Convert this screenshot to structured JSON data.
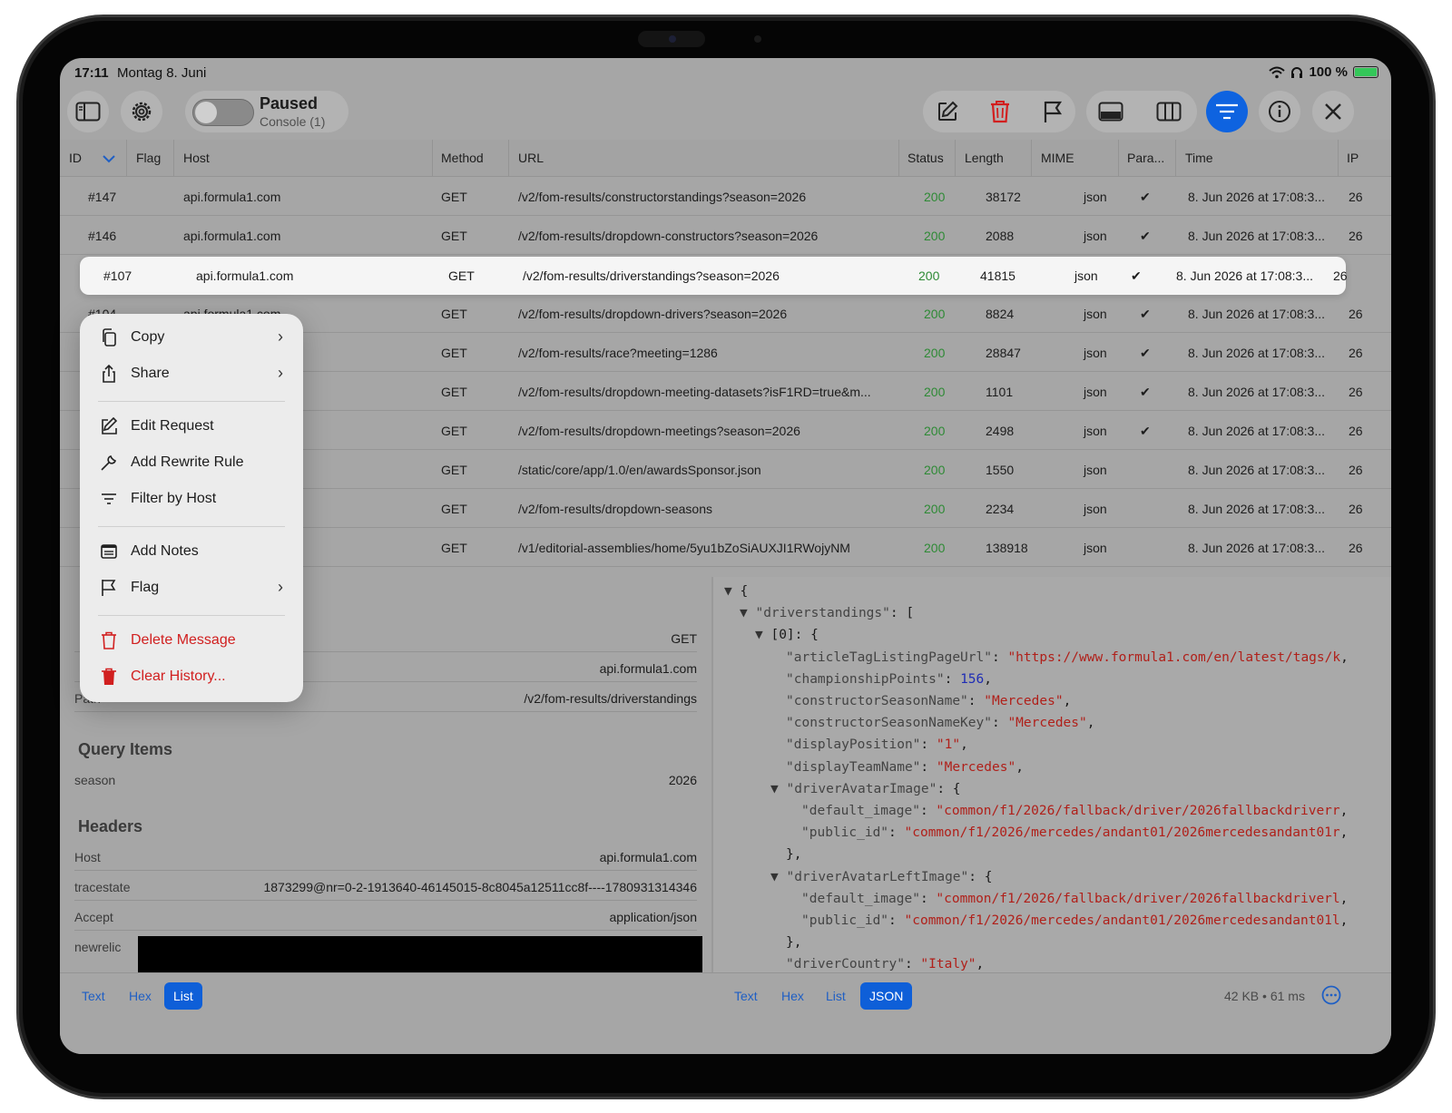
{
  "status_bar": {
    "time": "17:11",
    "date": "Montag 8. Juni",
    "battery": "100 %"
  },
  "toolbar": {
    "toggle_title": "Paused",
    "toggle_subtitle": "Console (1)",
    "accent": "#0e63e0"
  },
  "table": {
    "columns": [
      "ID",
      "Flag",
      "Host",
      "Method",
      "URL",
      "Status",
      "Length",
      "MIME",
      "Para...",
      "Time",
      "IP"
    ],
    "rows": [
      {
        "id": "#147",
        "host": "api.formula1.com",
        "method": "GET",
        "url": "/v2/fom-results/constructorstandings?season=2026",
        "status": "200",
        "length": "38172",
        "mime": "json",
        "params": "✔",
        "time": "8. Jun 2026 at 17:08:3...",
        "ip": "26"
      },
      {
        "id": "#146",
        "host": "api.formula1.com",
        "method": "GET",
        "url": "/v2/fom-results/dropdown-constructors?season=2026",
        "status": "200",
        "length": "2088",
        "mime": "json",
        "params": "✔",
        "time": "8. Jun 2026 at 17:08:3...",
        "ip": "26"
      },
      {
        "id": "#107",
        "host": "api.formula1.com",
        "method": "GET",
        "url": "/v2/fom-results/driverstandings?season=2026",
        "status": "200",
        "length": "41815",
        "mime": "json",
        "params": "✔",
        "time": "8. Jun 2026 at 17:08:3...",
        "ip": "26"
      },
      {
        "id": "#104",
        "host": "api.formula1.com",
        "method": "GET",
        "url": "/v2/fom-results/dropdown-drivers?season=2026",
        "status": "200",
        "length": "8824",
        "mime": "json",
        "params": "✔",
        "time": "8. Jun 2026 at 17:08:3...",
        "ip": "26"
      },
      {
        "id": "",
        "host": "",
        "method": "GET",
        "url": "/v2/fom-results/race?meeting=1286",
        "status": "200",
        "length": "28847",
        "mime": "json",
        "params": "✔",
        "time": "8. Jun 2026 at 17:08:3...",
        "ip": "26"
      },
      {
        "id": "",
        "host": "",
        "method": "GET",
        "url": "/v2/fom-results/dropdown-meeting-datasets?isF1RD=true&m...",
        "status": "200",
        "length": "1101",
        "mime": "json",
        "params": "✔",
        "time": "8. Jun 2026 at 17:08:3...",
        "ip": "26"
      },
      {
        "id": "",
        "host": "",
        "method": "GET",
        "url": "/v2/fom-results/dropdown-meetings?season=2026",
        "status": "200",
        "length": "2498",
        "mime": "json",
        "params": "✔",
        "time": "8. Jun 2026 at 17:08:3...",
        "ip": "26"
      },
      {
        "id": "",
        "host": "",
        "method": "GET",
        "url": "/static/core/app/1.0/en/awardsSponsor.json",
        "status": "200",
        "length": "1550",
        "mime": "json",
        "params": "",
        "time": "8. Jun 2026 at 17:08:3...",
        "ip": "26"
      },
      {
        "id": "",
        "host": "",
        "method": "GET",
        "url": "/v2/fom-results/dropdown-seasons",
        "status": "200",
        "length": "2234",
        "mime": "json",
        "params": "",
        "time": "8. Jun 2026 at 17:08:3...",
        "ip": "26"
      },
      {
        "id": "",
        "host": "",
        "method": "GET",
        "url": "/v1/editorial-assemblies/home/5yu1bZoSiAUXJI1RWojyNM",
        "status": "200",
        "length": "138918",
        "mime": "json",
        "params": "",
        "time": "8. Jun 2026 at 17:08:3...",
        "ip": "26"
      }
    ]
  },
  "context_menu": {
    "items": [
      "Copy",
      "Share",
      "Edit Request",
      "Add Rewrite Rule",
      "Filter by Host",
      "Add Notes",
      "Flag",
      "Delete Message",
      "Clear History..."
    ]
  },
  "request": {
    "method_value": "GET",
    "host_value": "api.formula1.com",
    "path_label": "Path",
    "path_value": "/v2/fom-results/driverstandings",
    "query_title": "Query Items",
    "query_items": [
      {
        "key": "season",
        "value": "2026"
      }
    ],
    "headers_title": "Headers",
    "headers": [
      {
        "key": "Host",
        "value": "api.formula1.com"
      },
      {
        "key": "tracestate",
        "value": "1873299@nr=0-2-1913640-46145015-8c8045a12511cc8f----1780931314346"
      },
      {
        "key": "Accept",
        "value": "application/json"
      },
      {
        "key": "newrelic",
        "value": ""
      }
    ]
  },
  "json_view": {
    "lines": [
      {
        "t": "▼ ",
        "k": "{",
        "v": "",
        "indent": 0,
        "kind": "p"
      },
      {
        "t": "▼ ",
        "k": "\"driverstandings\"",
        "v": ": [",
        "indent": 1,
        "kind": "pk"
      },
      {
        "t": "▼ ",
        "k": "[0]: {",
        "v": "",
        "indent": 2,
        "kind": "p"
      },
      {
        "t": "",
        "k": "\"articleTagListingPageUrl\"",
        "v": "\"https://www.formula1.com/en/latest/tags/k",
        "indent": 4,
        "kind": "s"
      },
      {
        "t": "",
        "k": "\"championshipPoints\"",
        "v": "156",
        "indent": 4,
        "kind": "n"
      },
      {
        "t": "",
        "k": "\"constructorSeasonName\"",
        "v": "\"Mercedes\"",
        "indent": 4,
        "kind": "s"
      },
      {
        "t": "",
        "k": "\"constructorSeasonNameKey\"",
        "v": "\"Mercedes\"",
        "indent": 4,
        "kind": "s"
      },
      {
        "t": "",
        "k": "\"displayPosition\"",
        "v": "\"1\"",
        "indent": 4,
        "kind": "s"
      },
      {
        "t": "",
        "k": "\"displayTeamName\"",
        "v": "\"Mercedes\"",
        "indent": 4,
        "kind": "s"
      },
      {
        "t": "▼ ",
        "k": "\"driverAvatarImage\"",
        "v": ": {",
        "indent": 3,
        "kind": "pk"
      },
      {
        "t": "",
        "k": "\"default_image\"",
        "v": "\"common/f1/2026/fallback/driver/2026fallbackdriverr",
        "indent": 5,
        "kind": "s"
      },
      {
        "t": "",
        "k": "\"public_id\"",
        "v": "\"common/f1/2026/mercedes/andant01/2026mercedesandant01r",
        "indent": 5,
        "kind": "s"
      },
      {
        "t": "",
        "k": "},",
        "v": "",
        "indent": 4,
        "kind": "p"
      },
      {
        "t": "▼ ",
        "k": "\"driverAvatarLeftImage\"",
        "v": ": {",
        "indent": 3,
        "kind": "pk"
      },
      {
        "t": "",
        "k": "\"default_image\"",
        "v": "\"common/f1/2026/fallback/driver/2026fallbackdriverl",
        "indent": 5,
        "kind": "s"
      },
      {
        "t": "",
        "k": "\"public_id\"",
        "v": "\"common/f1/2026/mercedes/andant01/2026mercedesandant01l",
        "indent": 5,
        "kind": "s"
      },
      {
        "t": "",
        "k": "},",
        "v": "",
        "indent": 4,
        "kind": "p"
      },
      {
        "t": "",
        "k": "\"driverCountry\"",
        "v": "\"Italy\"",
        "indent": 4,
        "kind": "s"
      }
    ]
  },
  "bottom_left_tabs": [
    "Text",
    "Hex",
    "List"
  ],
  "bottom_right_tabs": [
    "Text",
    "Hex",
    "List",
    "JSON"
  ],
  "size_info": "42 KB • 61 ms"
}
